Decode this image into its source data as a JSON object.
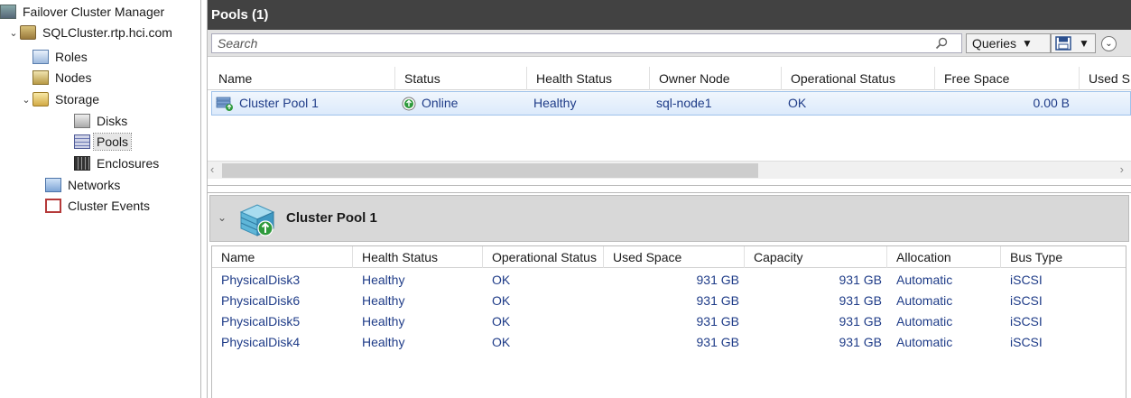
{
  "tree": {
    "root": "Failover Cluster Manager",
    "cluster": "SQLCluster.rtp.hci.com",
    "roles": "Roles",
    "nodes": "Nodes",
    "storage": "Storage",
    "disks": "Disks",
    "pools": "Pools",
    "enclosures": "Enclosures",
    "networks": "Networks",
    "cluster_events": "Cluster Events"
  },
  "main": {
    "title": "Pools (1)",
    "search_placeholder": "Search",
    "queries_label": "Queries"
  },
  "pools_grid": {
    "columns": [
      "Name",
      "Status",
      "Health Status",
      "Owner Node",
      "Operational Status",
      "Free Space",
      "Used S"
    ],
    "rows": [
      {
        "name": "Cluster Pool 1",
        "status": "Online",
        "health": "Healthy",
        "owner": "sql-node1",
        "operational": "OK",
        "free_space": "0.00 B"
      }
    ]
  },
  "detail": {
    "title": "Cluster Pool 1",
    "columns": [
      "Name",
      "Health Status",
      "Operational Status",
      "Used Space",
      "Capacity",
      "Allocation",
      "Bus Type"
    ],
    "rows": [
      {
        "name": "PhysicalDisk3",
        "health": "Healthy",
        "operational": "OK",
        "used": "931 GB",
        "capacity": "931 GB",
        "allocation": "Automatic",
        "bus": "iSCSI"
      },
      {
        "name": "PhysicalDisk6",
        "health": "Healthy",
        "operational": "OK",
        "used": "931 GB",
        "capacity": "931 GB",
        "allocation": "Automatic",
        "bus": "iSCSI"
      },
      {
        "name": "PhysicalDisk5",
        "health": "Healthy",
        "operational": "OK",
        "used": "931 GB",
        "capacity": "931 GB",
        "allocation": "Automatic",
        "bus": "iSCSI"
      },
      {
        "name": "PhysicalDisk4",
        "health": "Healthy",
        "operational": "OK",
        "used": "931 GB",
        "capacity": "931 GB",
        "allocation": "Automatic",
        "bus": "iSCSI"
      }
    ]
  },
  "colors": {
    "title_bar": "#424242",
    "link_text": "#1f3c88",
    "selected_row": "#dceafb",
    "online_green": "#2e9a3c"
  }
}
